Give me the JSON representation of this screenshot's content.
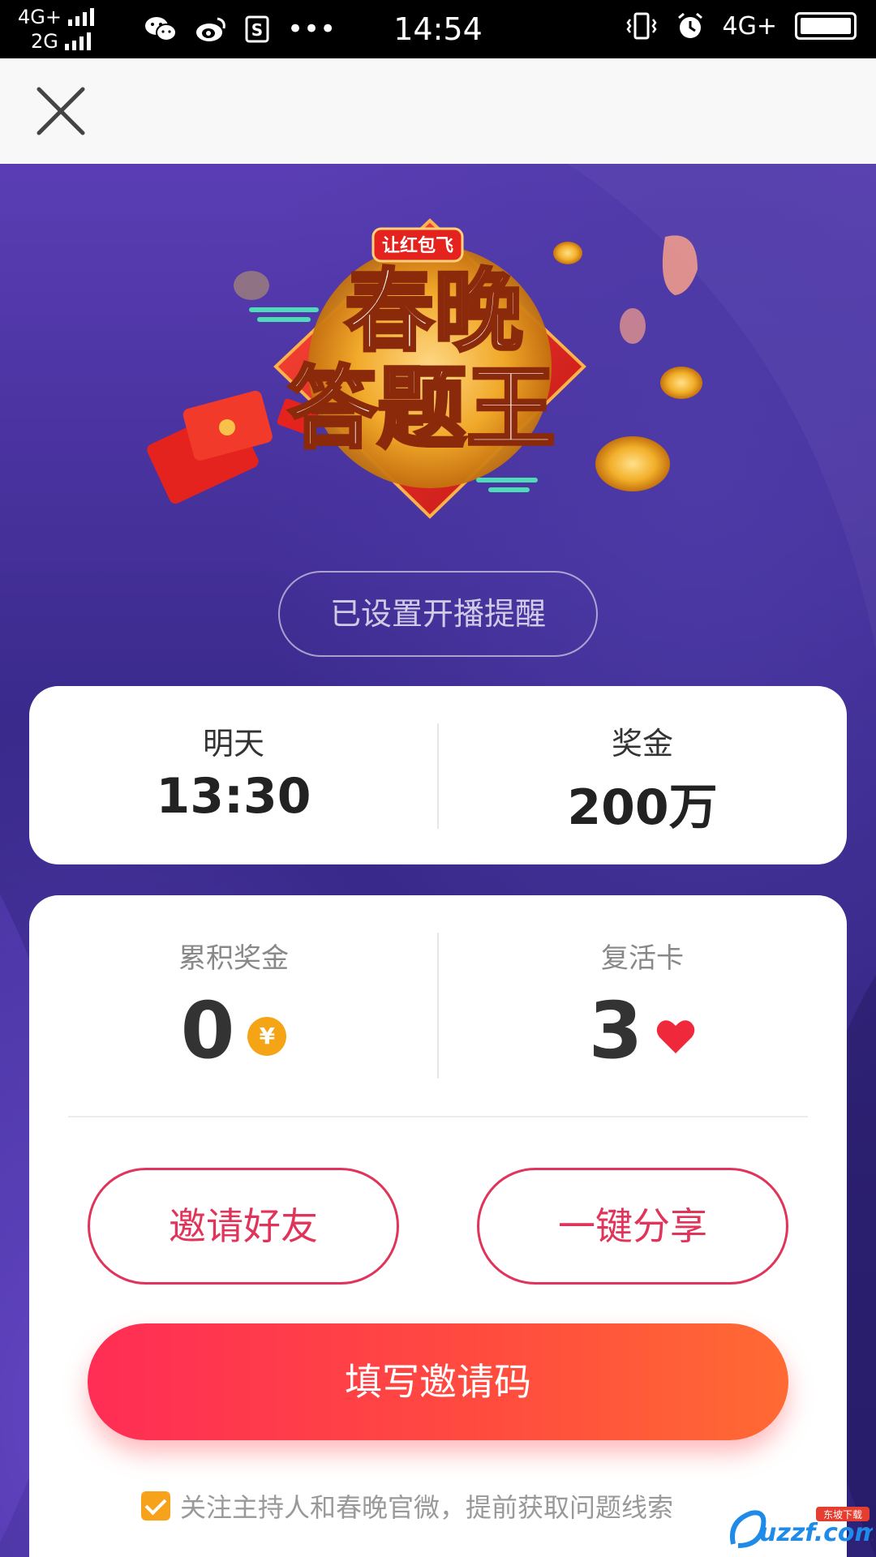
{
  "status_bar": {
    "network_1": "4G+",
    "network_2": "2G",
    "time": "14:54",
    "right_network": "4G+",
    "more": "•••"
  },
  "hero": {
    "logo_small": "让红包飞",
    "logo_line1": "春晚",
    "logo_line2": "答题王"
  },
  "reminder_button": "已设置开播提醒",
  "schedule": {
    "time_label": "明天",
    "time_value": "13:30",
    "prize_label": "奖金",
    "prize_value": "200万"
  },
  "stats": {
    "bonus_label": "累积奖金",
    "bonus_value": "0",
    "bonus_icon": "yuan-coin-icon",
    "bonus_symbol": "¥",
    "revive_label": "复活卡",
    "revive_value": "3",
    "revive_icon": "heart-icon"
  },
  "actions": {
    "invite_friends": "邀请好友",
    "share": "一键分享",
    "invite_code": "填写邀请码"
  },
  "follow": {
    "checked": true,
    "text": "关注主持人和春晚官微，提前获取问题线索"
  },
  "watermark": {
    "brand": "uzzf.com",
    "tag": "东坡下载"
  },
  "colors": {
    "accent": "#e0345a",
    "gradient_start": "#ff2d55",
    "gradient_end": "#ff6a33",
    "coin": "#f5a416",
    "heart": "#f0283c",
    "checkbox": "#f7a21b",
    "background": "#3a2a8c"
  }
}
